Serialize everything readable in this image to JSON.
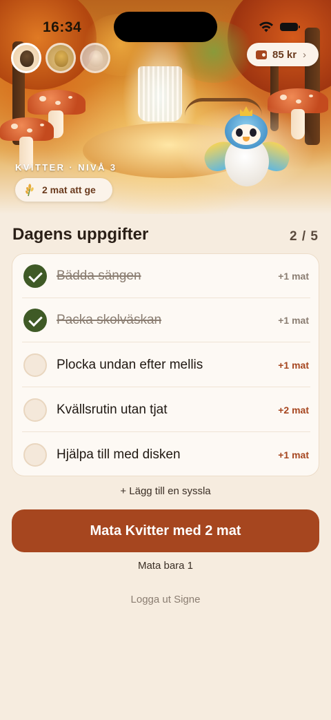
{
  "status_bar": {
    "time": "16:34"
  },
  "header": {
    "wallet": {
      "amount": "85 kr",
      "icon": "wallet-icon"
    },
    "pet_label": "KVITTER · NIVÅ 3",
    "food_pill": {
      "text": "2 mat att ge",
      "icon": "wheat-icon"
    }
  },
  "tasks": {
    "title": "Dagens uppgifter",
    "progress": "2 / 5",
    "items": [
      {
        "label": "Bädda sängen",
        "reward": "+1 mat",
        "done": true
      },
      {
        "label": "Packa skolväskan",
        "reward": "+1 mat",
        "done": true
      },
      {
        "label": "Plocka undan efter mellis",
        "reward": "+1 mat",
        "done": false
      },
      {
        "label": "Kvällsrutin utan tjat",
        "reward": "+2 mat",
        "done": false
      },
      {
        "label": "Hjälpa till med disken",
        "reward": "+1 mat",
        "done": false
      }
    ],
    "add_label": "+ Lägg till en syssla"
  },
  "actions": {
    "feed_label": "Mata Kvitter med 2 mat",
    "feed_one_label": "Mata bara 1",
    "logout_label": "Logga ut Signe"
  },
  "colors": {
    "accent": "#a6461f",
    "done_check": "#3f5a26",
    "background": "#f6ecdf"
  }
}
